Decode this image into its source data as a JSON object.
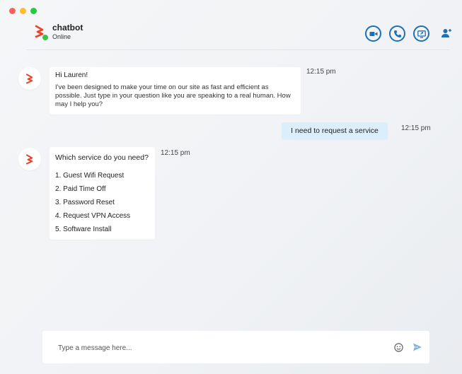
{
  "header": {
    "bot_name": "chatbot",
    "status": "Online"
  },
  "messages": [
    {
      "from": "bot",
      "greeting": "Hi Lauren!",
      "body": "I've been designed to make your time on our site as fast and efficient as possible. Just type in your question like you are speaking to a real human. How may I help you?",
      "time": "12:15 pm"
    },
    {
      "from": "user",
      "text": "I need to request a service",
      "time": "12:15 pm"
    },
    {
      "from": "bot",
      "question": "Which service do you need?",
      "options": [
        "1. Guest Wifi Request",
        "2. Paid Time Off",
        "3. Password Reset",
        "4. Request VPN Access",
        "5. Software Install"
      ],
      "time": "12:15 pm"
    }
  ],
  "composer": {
    "placeholder": "Type a message here..."
  },
  "icons": {
    "video": "video-call-icon",
    "phone": "phone-icon",
    "share": "screen-share-icon",
    "add_user": "add-user-icon",
    "emoji": "emoji-icon",
    "send": "send-icon"
  },
  "colors": {
    "accent": "#1f6fb5",
    "brand": "#e8462b",
    "online": "#3fc24a",
    "user_bubble": "#dbeefb"
  }
}
